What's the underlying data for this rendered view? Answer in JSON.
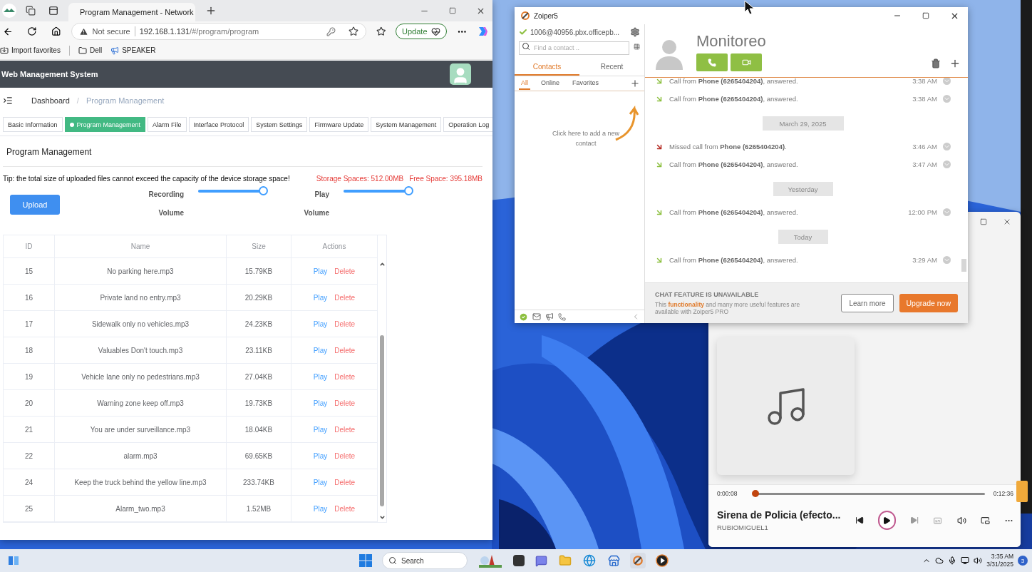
{
  "browser": {
    "tabs": [
      {
        "title": "Program Management - Network",
        "selected": true
      }
    ],
    "address": {
      "security": "Not secure",
      "host": "192.168.1.131",
      "path": "/#/program/program"
    },
    "update_button": "Update",
    "bookmarks": [
      {
        "kind": "import",
        "label": "Import favorites"
      },
      {
        "kind": "folder",
        "label": "Dell"
      },
      {
        "kind": "site",
        "label": "SPEAKER"
      }
    ]
  },
  "app": {
    "title": "Web Management System",
    "breadcrumb": [
      "Dashboard",
      "Program Management"
    ],
    "breadcrumb_separator": "/",
    "tabs": [
      {
        "label": "Basic Information",
        "selected": false
      },
      {
        "label": "Program Management",
        "selected": true
      },
      {
        "label": "Alarm File",
        "selected": false
      },
      {
        "label": "Interface Protocol",
        "selected": false
      },
      {
        "label": "System Settings",
        "selected": false
      },
      {
        "label": "Firmware Update",
        "selected": false
      },
      {
        "label": "System Management",
        "selected": false
      },
      {
        "label": "Operation Log",
        "selected": false
      }
    ],
    "section_title": "Program Management",
    "tip": "Tip: the total size of uploaded files cannot exceed the capacity of the device storage space!",
    "storage": "Storage Spaces: 512.00MB",
    "free_space": "Free Space: 395.18MB",
    "upload_button": "Upload",
    "sliders": [
      {
        "label": [
          "Recording",
          "Volume"
        ],
        "level": 1
      },
      {
        "label": [
          "Play",
          "Volume"
        ],
        "level": 1
      }
    ],
    "table": {
      "columns": [
        "ID",
        "Name",
        "Size",
        "Actions"
      ],
      "rows": [
        {
          "id": "15",
          "name": "No parking here.mp3",
          "size": "15.79KB",
          "actions": [
            "Play",
            "Delete"
          ]
        },
        {
          "id": "16",
          "name": "Private land no entry.mp3",
          "size": "20.29KB",
          "actions": [
            "Play",
            "Delete"
          ]
        },
        {
          "id": "17",
          "name": "Sidewalk only no vehicles.mp3",
          "size": "24.23KB",
          "actions": [
            "Play",
            "Delete"
          ]
        },
        {
          "id": "18",
          "name": "Valuables Don't touch.mp3",
          "size": "23.11KB",
          "actions": [
            "Play",
            "Delete"
          ]
        },
        {
          "id": "19",
          "name": "Vehicle lane only no pedestrians.mp3",
          "size": "27.04KB",
          "actions": [
            "Play",
            "Delete"
          ]
        },
        {
          "id": "20",
          "name": "Warning zone keep off.mp3",
          "size": "19.73KB",
          "actions": [
            "Play",
            "Delete"
          ]
        },
        {
          "id": "21",
          "name": "You are under surveillance.mp3",
          "size": "18.04KB",
          "actions": [
            "Play",
            "Delete"
          ]
        },
        {
          "id": "22",
          "name": "alarm.mp3",
          "size": "69.65KB",
          "actions": [
            "Play",
            "Delete"
          ]
        },
        {
          "id": "24",
          "name": "Keep the truck behind the yellow line.mp3",
          "size": "233.74KB",
          "actions": [
            "Play",
            "Delete"
          ]
        },
        {
          "id": "25",
          "name": "Alarm_two.mp3",
          "size": "1.52MB",
          "actions": [
            "Play",
            "Delete"
          ]
        }
      ]
    }
  },
  "zoiper": {
    "title": "Zoiper5",
    "account": "1006@40956.pbx.officepb...",
    "search_placeholder": "Find a contact ..",
    "tabs": [
      {
        "label": "Contacts",
        "selected": true
      },
      {
        "label": "Recent",
        "selected": false
      }
    ],
    "filters": [
      {
        "label": "All",
        "selected": true
      },
      {
        "label": "Online",
        "selected": false
      },
      {
        "label": "Favorites",
        "selected": false
      }
    ],
    "hint": "Click here to add a new contact",
    "contact": "Monitoreo",
    "history": [
      {
        "kind": "call",
        "text": "Call from **Phone (6265404204)**, answered.",
        "time": "3:38 AM"
      },
      {
        "kind": "call",
        "text": "Call from **Phone (6265404204)**, answered.",
        "time": "3:38 AM"
      },
      {
        "kind": "date",
        "text": "March 29, 2025"
      },
      {
        "kind": "missed",
        "text": "Missed call from **Phone (6265404204)**.",
        "time": "3:46 AM"
      },
      {
        "kind": "call",
        "text": "Call from **Phone (6265404204)**, answered.",
        "time": "3:47 AM"
      },
      {
        "kind": "date",
        "text": "Yesterday"
      },
      {
        "kind": "call",
        "text": "Call from **Phone (6265404204)**, answered.",
        "time": "12:00 PM"
      },
      {
        "kind": "date",
        "text": "Today"
      },
      {
        "kind": "call",
        "text": "Call from **Phone (6265404204)**, answered.",
        "time": "3:29 AM"
      }
    ],
    "chat": {
      "title": "CHAT FEATURE IS UNAVAILABLE",
      "text": "This **functionality** and many more useful features are available with Zoiper5 PRO",
      "learn_more": "Learn more",
      "upgrade": "Upgrade now"
    }
  },
  "player": {
    "elapsed": "0:00:08",
    "total": "0:12:36",
    "level": 0.01,
    "title": "Sirena de Policia (efecto...",
    "artist": "RUBIOMIGUEL1"
  },
  "taskbar": {
    "search": "Search",
    "time": "3:35 AM",
    "date": "3/31/2025",
    "badge": "3"
  }
}
